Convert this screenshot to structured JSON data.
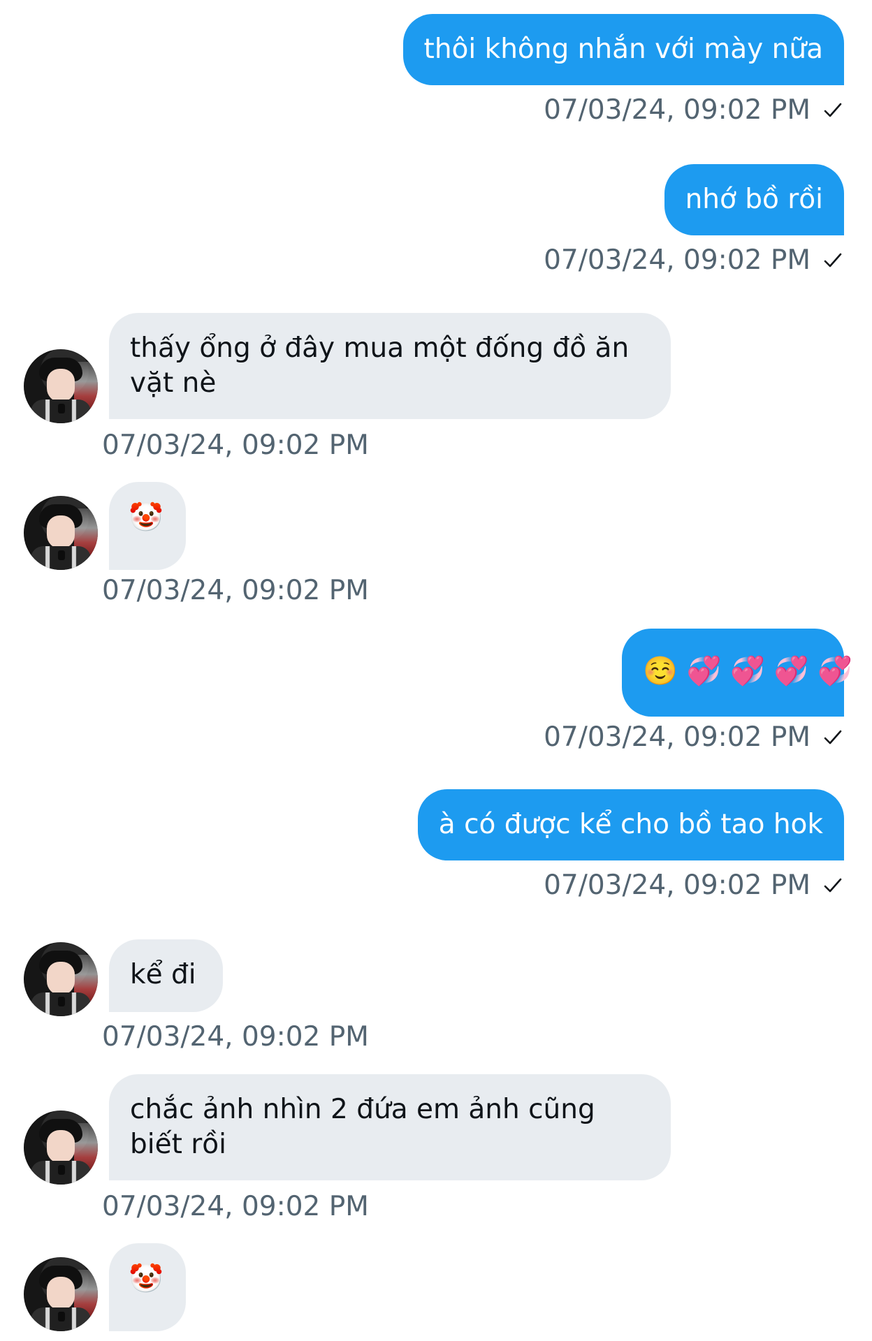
{
  "messages": [
    {
      "direction": "out",
      "text": "thôi không nhắn với mày nữa",
      "timestamp": "07/03/24, 09:02 PM",
      "status_icon": "check-icon"
    },
    {
      "direction": "out",
      "text": "nhớ bồ rồi",
      "timestamp": "07/03/24, 09:02 PM",
      "status_icon": "check-icon"
    },
    {
      "direction": "in",
      "text": "thấy ổng ở đây mua một đống đồ ăn vặt nè",
      "timestamp": "07/03/24, 09:02 PM",
      "avatar_icon": "avatar"
    },
    {
      "direction": "in",
      "text": "🤡",
      "timestamp": "07/03/24, 09:02 PM",
      "avatar_icon": "avatar"
    },
    {
      "direction": "out",
      "text": "☺️ 💞 💞 💞 💞",
      "timestamp": "07/03/24, 09:02 PM",
      "status_icon": "check-icon"
    },
    {
      "direction": "out",
      "text": "à có được kể cho bồ tao hok",
      "timestamp": "07/03/24, 09:02 PM",
      "status_icon": "check-icon"
    },
    {
      "direction": "in",
      "text": "kể đi",
      "timestamp": "07/03/24, 09:02 PM",
      "avatar_icon": "avatar"
    },
    {
      "direction": "in",
      "text": "chắc ảnh nhìn 2 đứa em ảnh cũng biết rồi",
      "timestamp": "07/03/24, 09:02 PM",
      "avatar_icon": "avatar"
    },
    {
      "direction": "in",
      "text": "🤡",
      "avatar_icon": "avatar"
    }
  ],
  "colors": {
    "outgoing_bubble": "#1d9bf0",
    "incoming_bubble": "#e8ecf0",
    "timestamp": "#536471",
    "incoming_text": "#0f1419",
    "outgoing_text": "#ffffff"
  }
}
